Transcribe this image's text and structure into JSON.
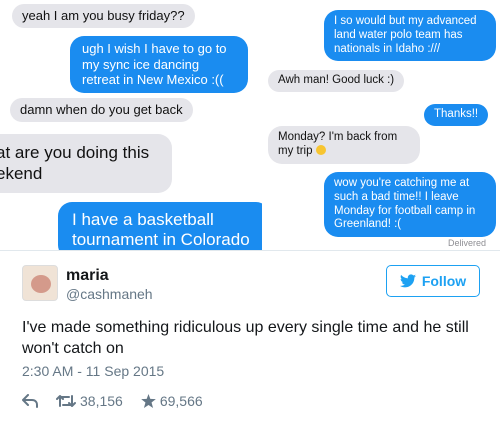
{
  "conversation": {
    "messages_left": [
      {
        "text": "yeah I am you busy friday??"
      },
      {
        "text": "ugh I wish I have to go to my sync ice dancing retreat in New Mexico :(("
      },
      {
        "text": "damn when do you get back"
      },
      {
        "text": "at are you doing this ekend"
      },
      {
        "text": "I have a basketball tournament in Colorado"
      }
    ],
    "messages_right": [
      {
        "text": "I so would but my advanced land water polo team has nationals in Idaho :///"
      },
      {
        "text": "Awh man! Good luck :)"
      },
      {
        "text": "Thanks!!"
      },
      {
        "text": "Monday? I'm back from my trip"
      },
      {
        "text": "wow you're catching me at such a bad time!! I leave Monday for football camp in Greenland! :("
      }
    ],
    "delivered_label": "Delivered"
  },
  "tweet": {
    "display_name": "maria",
    "handle": "@cashmaneh",
    "follow_label": "Follow",
    "text": "I've made something ridiculous up every single time and he still won't catch on",
    "timestamp": "2:30 AM - 11 Sep 2015",
    "retweets": "38,156",
    "likes": "69,566"
  },
  "colors": {
    "sent_bubble": "#1a8cf0",
    "received_bubble": "#e5e5ea",
    "twitter_blue": "#1da1f2",
    "secondary_text": "#657786"
  },
  "icons": [
    "twitter-bird-icon",
    "reply-icon",
    "retweet-icon",
    "like-star-icon",
    "smile-emoji-icon"
  ]
}
